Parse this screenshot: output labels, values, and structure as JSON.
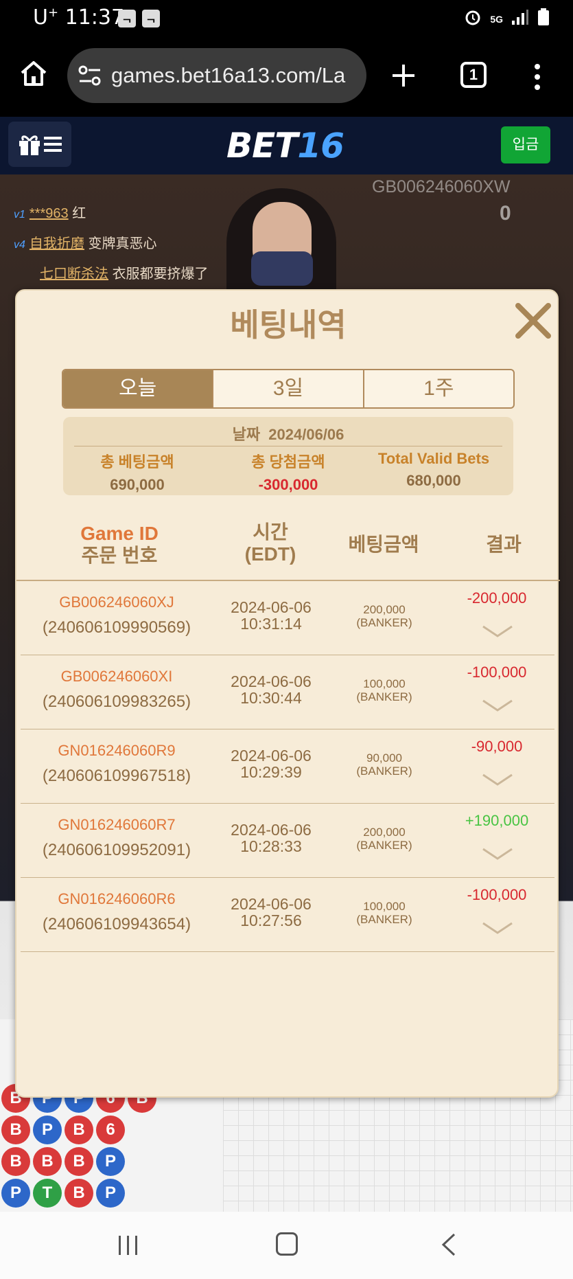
{
  "status_bar": {
    "carrier": "U",
    "carrier_sup": "+",
    "time": "11:37",
    "network": "5G"
  },
  "browser": {
    "url": "games.bet16a13.com/La",
    "tab_count": "1"
  },
  "site_header": {
    "logo_text": "BET",
    "logo_number": "16",
    "deposit_label": "입금"
  },
  "background": {
    "chat": [
      {
        "level": "v1",
        "name": "***963",
        "message": "红"
      },
      {
        "level": "v4",
        "name": "自我折磨",
        "message": "变牌真恶心"
      },
      {
        "level": "",
        "name": "七口断杀法",
        "message": "衣服都要挤爆了"
      }
    ],
    "game_code": "GB006246060XW",
    "balance": "0",
    "beads": [
      [
        "B",
        "P",
        "P",
        "6",
        "B"
      ],
      [
        "B",
        "P",
        "B",
        "6"
      ],
      [
        "B",
        "B",
        "B",
        "P"
      ],
      [
        "P",
        "T",
        "B",
        "P"
      ]
    ]
  },
  "modal": {
    "title": "베팅내역",
    "tabs": [
      {
        "label": "오늘",
        "active": true
      },
      {
        "label": "3일",
        "active": false
      },
      {
        "label": "1주",
        "active": false
      }
    ],
    "summary": {
      "date_label": "날짜",
      "date_value": "2024/06/06",
      "total_bet_label": "총 베팅금액",
      "total_bet_value": "690,000",
      "total_win_label": "총 당첨금액",
      "total_win_value": "-300,000",
      "valid_bets_label": "Total Valid Bets",
      "valid_bets_value": "680,000"
    },
    "columns": {
      "game_id": "Game ID",
      "order_no": "주문 번호",
      "time": "시간",
      "time_zone": "(EDT)",
      "bet_amount": "베팅금액",
      "result": "결과"
    },
    "rows": [
      {
        "game_id": "GB006246060XJ",
        "order_no": "(240606109990569)",
        "date": "2024-06-06",
        "time": "10:31:14",
        "amount": "200,000",
        "bet_on": "(BANKER)",
        "result": "-200,000",
        "positive": false
      },
      {
        "game_id": "GB006246060XI",
        "order_no": "(240606109983265)",
        "date": "2024-06-06",
        "time": "10:30:44",
        "amount": "100,000",
        "bet_on": "(BANKER)",
        "result": "-100,000",
        "positive": false
      },
      {
        "game_id": "GN016246060R9",
        "order_no": "(240606109967518)",
        "date": "2024-06-06",
        "time": "10:29:39",
        "amount": "90,000",
        "bet_on": "(BANKER)",
        "result": "-90,000",
        "positive": false
      },
      {
        "game_id": "GN016246060R7",
        "order_no": "(240606109952091)",
        "date": "2024-06-06",
        "time": "10:28:33",
        "amount": "200,000",
        "bet_on": "(BANKER)",
        "result": "+190,000",
        "positive": true
      },
      {
        "game_id": "GN016246060R6",
        "order_no": "(240606109943654)",
        "date": "2024-06-06",
        "time": "10:27:56",
        "amount": "100,000",
        "bet_on": "(BANKER)",
        "result": "-100,000",
        "positive": false
      }
    ]
  }
}
